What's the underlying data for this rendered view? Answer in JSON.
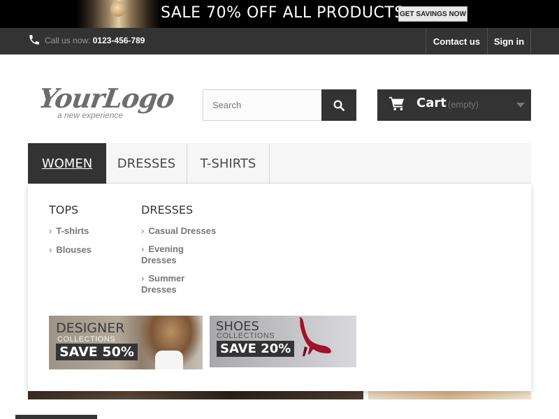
{
  "promo_banner": {
    "text": "SALE 70% OFF ALL PRODUCTS",
    "button_label": "GET SAVINGS NOW"
  },
  "topbar": {
    "call_label": "Call us now:",
    "phone": "0123-456-789",
    "contact_label": "Contact us",
    "signin_label": "Sign in"
  },
  "logo": {
    "main": "YourLogo",
    "tagline": "a new experience"
  },
  "search": {
    "placeholder": "Search",
    "icon": "search-icon"
  },
  "cart": {
    "label": "Cart",
    "state": "(empty)",
    "icon": "cart-icon"
  },
  "nav": {
    "tabs": [
      {
        "label": "WOMEN",
        "active": true
      },
      {
        "label": "DRESSES",
        "active": false
      },
      {
        "label": "T-SHIRTS",
        "active": false
      }
    ]
  },
  "dropdown": {
    "columns": [
      {
        "title": "TOPS",
        "items": [
          "T-shirts",
          "Blouses"
        ]
      },
      {
        "title": "DRESSES",
        "items": [
          "Casual Dresses",
          "Evening Dresses",
          "Summer Dresses"
        ]
      }
    ],
    "promos": [
      {
        "title": "DESIGNER",
        "subtitle": "COLLECTIONS",
        "offer": "SAVE 50%"
      },
      {
        "title": "SHOES",
        "subtitle": "COLLECTIONS",
        "offer": "SAVE 20%"
      }
    ]
  },
  "colors": {
    "dark": "#333333",
    "nav_bg": "#f6f6f6",
    "muted": "#777777"
  }
}
